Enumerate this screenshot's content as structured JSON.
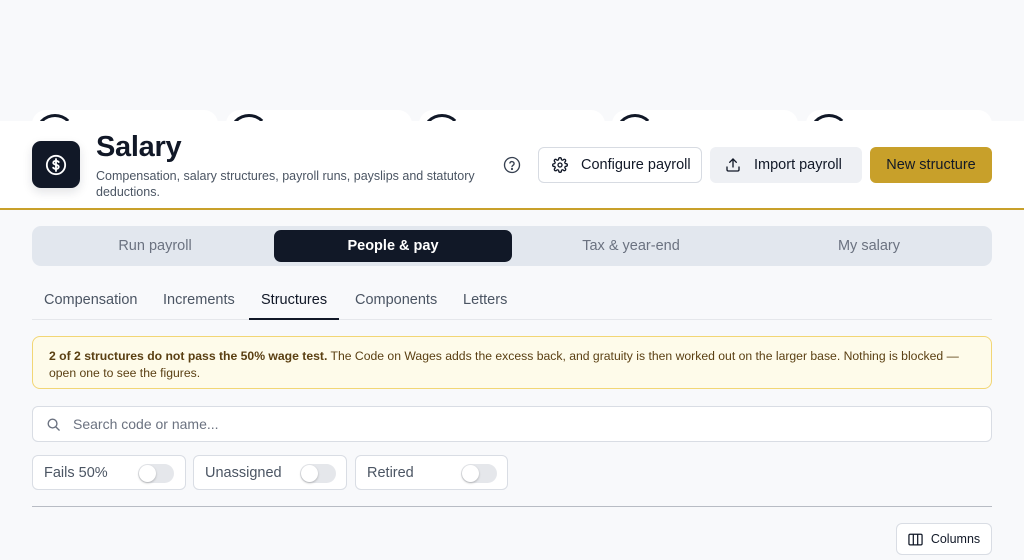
{
  "header": {
    "title": "Salary",
    "subtitle": "Compensation, salary structures, payroll runs, payslips and statutory deductions.",
    "buttons": {
      "configure": "Configure payroll",
      "import": "Import payroll",
      "new": "New structure"
    }
  },
  "tabs": [
    "Run payroll",
    "People & pay",
    "Tax & year-end",
    "My salary"
  ],
  "active_tab": "People & pay",
  "subtabs": [
    "Compensation",
    "Increments",
    "Structures",
    "Components",
    "Letters"
  ],
  "active_subtab": "Structures",
  "alert": {
    "bold": "2 of 2 structures do not pass the 50% wage test.",
    "text": " The Code on Wages adds the excess back, and gratuity is then worked out on the larger base. Nothing is blocked — open one to see the figures."
  },
  "search": {
    "placeholder": "Search code or name...",
    "value": ""
  },
  "filters": [
    {
      "label": "Fails 50%",
      "on": false
    },
    {
      "label": "Unassigned",
      "on": false
    },
    {
      "label": "Retired",
      "on": false
    }
  ],
  "columns_button": "Columns",
  "colors": {
    "accent": "#c8a02a",
    "dark": "#111827",
    "alert_bg": "#fefbea",
    "alert_border": "#f2d675"
  },
  "icons": {
    "app": "dollar-circle-icon",
    "help": "help-circle-icon",
    "configure": "gear-icon",
    "import": "upload-icon",
    "search": "search-icon",
    "columns": "columns-icon"
  }
}
